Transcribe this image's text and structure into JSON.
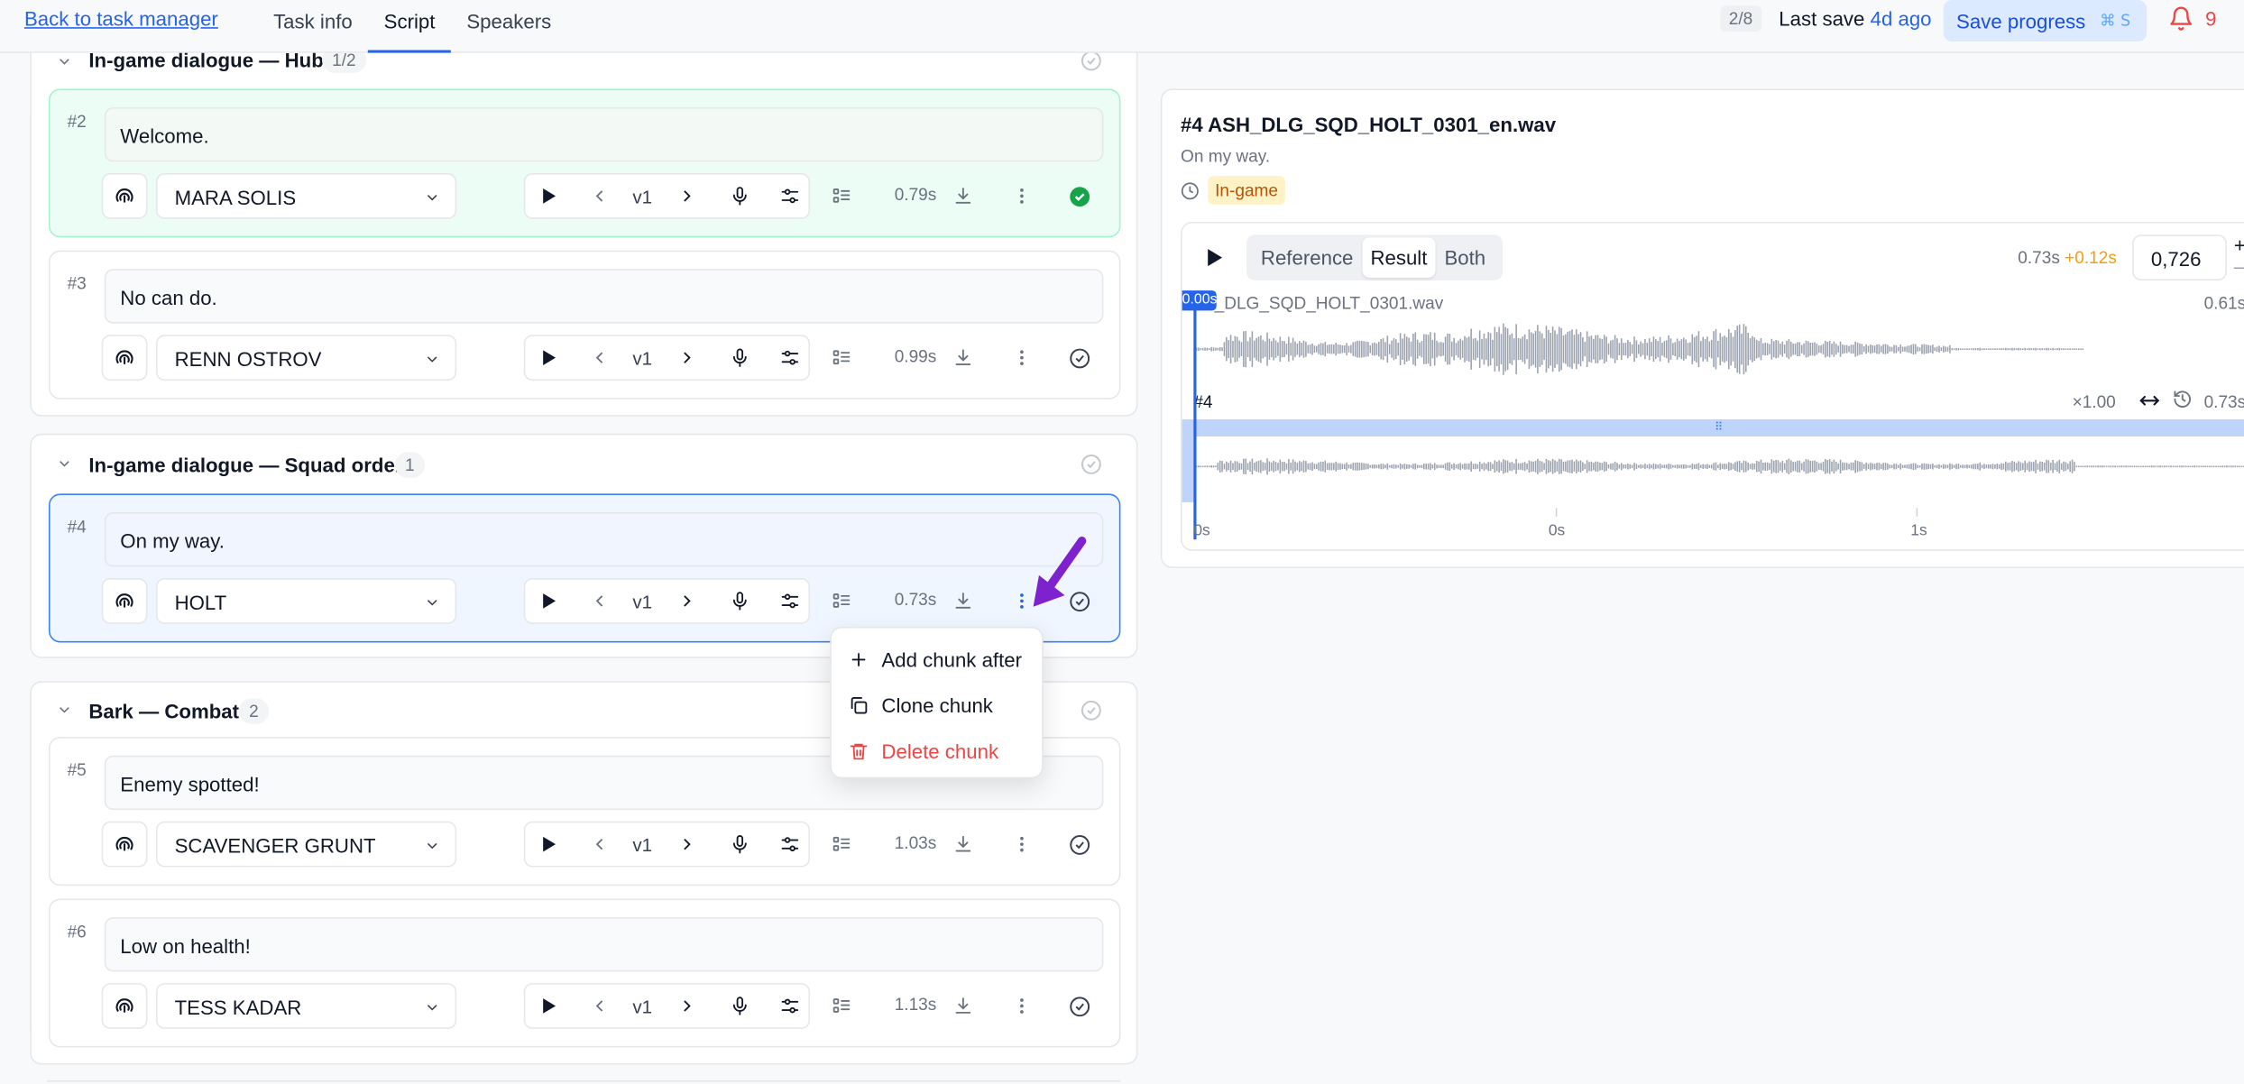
{
  "header": {
    "back_link": "Back to task manager",
    "tabs": [
      {
        "label": "Task info",
        "active": false
      },
      {
        "label": "Script",
        "active": true
      },
      {
        "label": "Speakers",
        "active": false
      }
    ],
    "pager": "2/8",
    "last_save_label": "Last save",
    "last_save_ago": "4d ago",
    "save_button": "Save progress",
    "save_shortcut": "⌘ S",
    "notifications_count": "9"
  },
  "groups": [
    {
      "title": "In-game dialogue — Hub",
      "count": "1/2",
      "chunks": [
        {
          "num": "#2",
          "text": "Welcome.",
          "speaker": "MARA SOLIS",
          "version": "v1",
          "duration": "0.79s",
          "status": "done"
        },
        {
          "num": "#3",
          "text": "No can do.",
          "speaker": "RENN OSTROV",
          "version": "v1",
          "duration": "0.99s",
          "status": "pending"
        }
      ]
    },
    {
      "title": "In-game dialogue — Squad order",
      "count": "1",
      "chunks": [
        {
          "num": "#4",
          "text": "On my way.",
          "speaker": "HOLT",
          "version": "v1",
          "duration": "0.73s",
          "status": "selected"
        }
      ]
    },
    {
      "title": "Bark — Combat",
      "count": "2",
      "chunks": [
        {
          "num": "#5",
          "text": "Enemy spotted!",
          "speaker": "SCAVENGER GRUNT",
          "version": "v1",
          "duration": "1.03s",
          "status": "pending"
        },
        {
          "num": "#6",
          "text": "Low on health!",
          "speaker": "TESS KADAR",
          "version": "v1",
          "duration": "1.13s",
          "status": "pending"
        }
      ]
    }
  ],
  "context_menu": {
    "items": [
      {
        "label": "Add chunk after",
        "icon": "plus-icon"
      },
      {
        "label": "Clone chunk",
        "icon": "copy-icon"
      },
      {
        "label": "Delete chunk",
        "icon": "trash-icon"
      }
    ]
  },
  "panel": {
    "title": "#4 ASH_DLG_SQD_HOLT_0301_en.wav",
    "subtitle": "On my way.",
    "badge": "In-game",
    "modes": [
      "Reference",
      "Result",
      "Both"
    ],
    "active_mode": "Result",
    "duration": "0.73s",
    "delta": "+0.12s",
    "value": "0,726",
    "plus": "+",
    "minus": "–",
    "reference_file": "H_DLG_SQD_HOLT_0301.wav",
    "playhead_time": "0.00s",
    "reference_end": "0.61s",
    "result_label": "#4",
    "result_scale": "×1.00",
    "result_time": "0.73s",
    "ticks": [
      "0s",
      "0s",
      "1s"
    ]
  },
  "colors": {
    "accent": "#2563eb",
    "done": "#16a34a",
    "danger": "#ef4444",
    "warning": "#f59e0b",
    "annotation_arrow": "#7e22ce"
  }
}
